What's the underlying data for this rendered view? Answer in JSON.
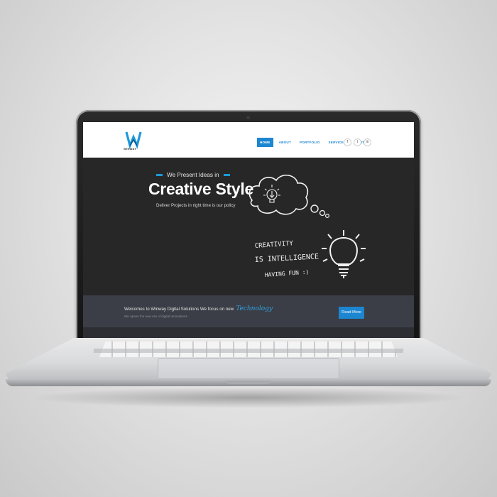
{
  "site": {
    "logo_text": "WINWAY",
    "nav": [
      {
        "label": "HOME",
        "active": true
      },
      {
        "label": "ABOUT",
        "active": false
      },
      {
        "label": "PORTFOLIO",
        "active": false
      },
      {
        "label": "SERVICES",
        "active": false
      },
      {
        "label": "CONTACT",
        "active": false
      }
    ],
    "social": [
      "f",
      "t",
      "in"
    ],
    "hero": {
      "tagline": "We Present Ideas in",
      "title": "Creative Style",
      "subtitle": "Deliver Projects in right time is our policy",
      "doodle_lines": [
        "CREATIVITY",
        "IS INTELLIGENCE",
        "HAVING FUN :)"
      ]
    },
    "strip": {
      "welcome": "Welcomes to Winway Digital Solutions We focus on new",
      "highlight": "Technology",
      "sub": "We opens the new era of digital innovations",
      "button": "Read More"
    }
  },
  "colors": {
    "accent": "#1c86d1",
    "hero_bg": "#272727",
    "strip_bg": "#3b3e46"
  }
}
